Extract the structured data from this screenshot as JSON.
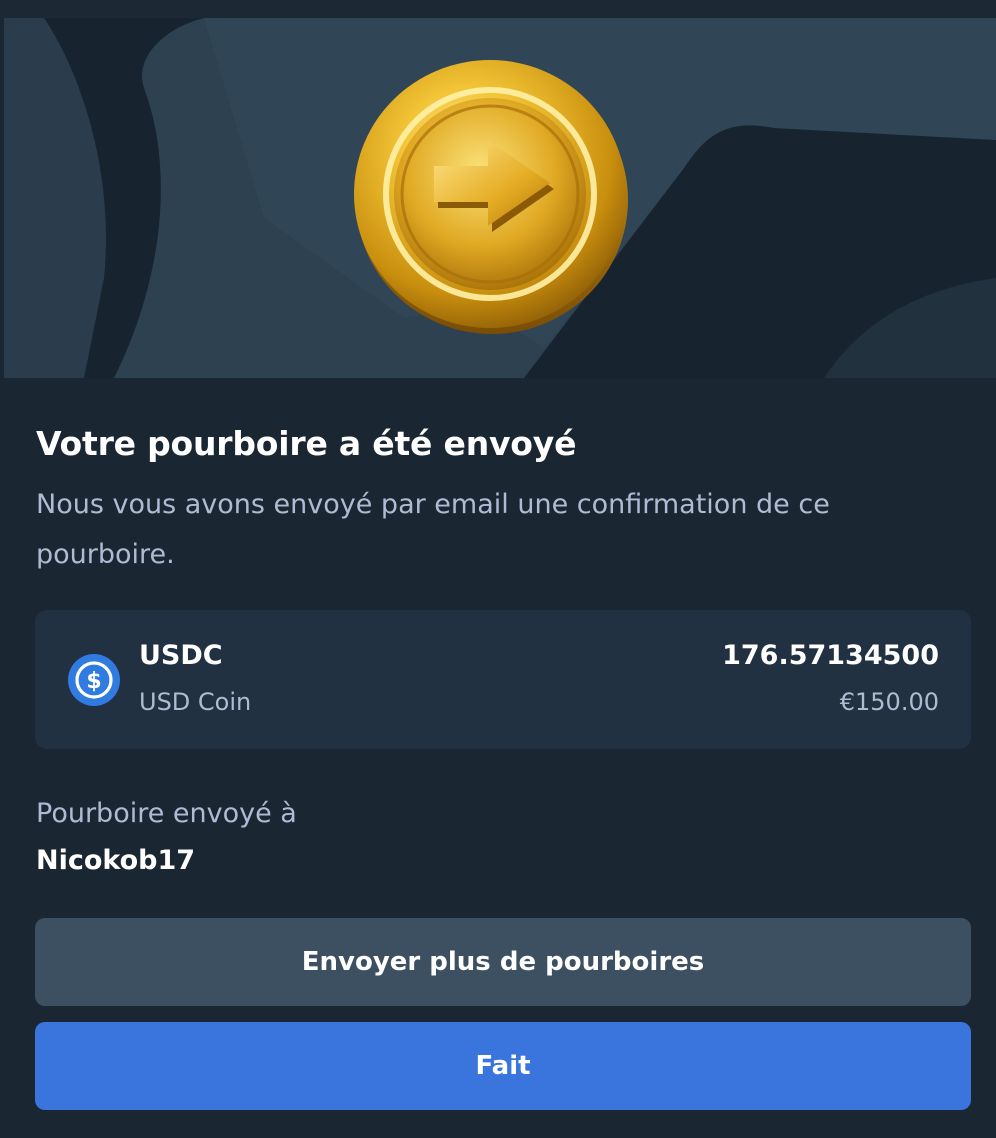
{
  "hero": {
    "illustration": "gold-coin-arrow-icon"
  },
  "dialog": {
    "title": "Votre pourboire a été envoyé",
    "subtitle": "Nous vous avons envoyé par email une confirmation de ce pourboire."
  },
  "token": {
    "icon": "usdc-icon",
    "symbol": "USDC",
    "name": "USD Coin",
    "amount": "176.57134500",
    "fiat": "€150.00",
    "icon_color": "#2f7be0"
  },
  "recipient": {
    "label": "Pourboire envoyé à",
    "name": "Nicokob17"
  },
  "buttons": {
    "send_more": "Envoyer plus de pourboires",
    "done": "Fait"
  },
  "colors": {
    "background": "#1a2732",
    "card": "#213141",
    "secondary_button": "#3c5061",
    "primary_button": "#3a75de",
    "muted_text": "#b1bad3"
  }
}
